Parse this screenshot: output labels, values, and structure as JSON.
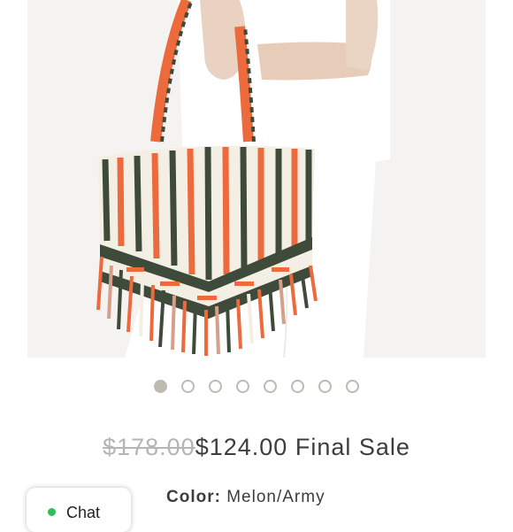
{
  "listing": {
    "image_alt": "Striped woven tote bag with fringe",
    "carousel": {
      "total": 8,
      "active": 1
    },
    "price_original": "$178.00",
    "price_current": "$124.00",
    "sale_label": "Final Sale",
    "color_label": "Color:",
    "color_value": "Melon/Army"
  },
  "chat": {
    "label": "Chat",
    "status_color": "#2fbf5a"
  },
  "colors": {
    "melon": "#ec6a3c",
    "army": "#3f4b3a",
    "cream": "#f4efe4",
    "dot": "#bdbab4"
  }
}
